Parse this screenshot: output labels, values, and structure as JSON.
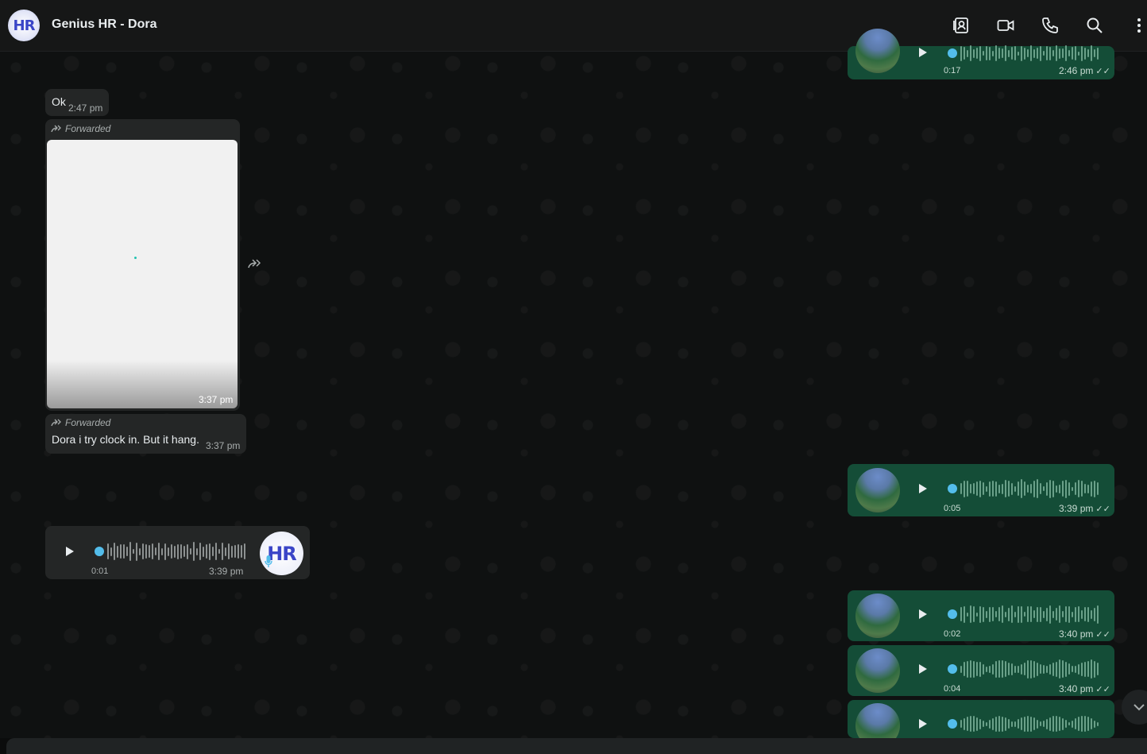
{
  "header": {
    "title": "Genius HR - Dora",
    "avatar_text": "HR",
    "icons": [
      "contact-card-icon",
      "video-call-icon",
      "phone-icon",
      "search-icon",
      "menu-icon"
    ]
  },
  "messages": {
    "top_voice": {
      "duration": "0:17",
      "time": "2:46 pm",
      "ticks": "✓✓"
    },
    "ok": {
      "text": "Ok",
      "time": "2:47 pm"
    },
    "forwarded_image": {
      "forwarded_label": "Forwarded",
      "time": "3:37 pm"
    },
    "forwarded_text": {
      "forwarded_label": "Forwarded",
      "text": "Dora i try clock in. But it hang.",
      "time": "3:37 pm"
    },
    "out_voice_1": {
      "duration": "0:05",
      "time": "3:39 pm",
      "ticks": "✓✓"
    },
    "in_voice": {
      "duration": "0:01",
      "time": "3:39 pm",
      "avatar_text": "HR"
    },
    "out_voice_2": {
      "duration": "0:02",
      "time": "3:40 pm",
      "ticks": "✓✓"
    },
    "out_voice_3": {
      "duration": "0:04",
      "time": "3:40 pm",
      "ticks": "✓✓"
    },
    "out_voice_4": {}
  },
  "colors": {
    "header_bg": "#161717",
    "chat_bg": "#0f1111",
    "incoming_bubble": "#242626",
    "outgoing_bubble": "#144d37",
    "accent_blue": "#53bdeb"
  }
}
